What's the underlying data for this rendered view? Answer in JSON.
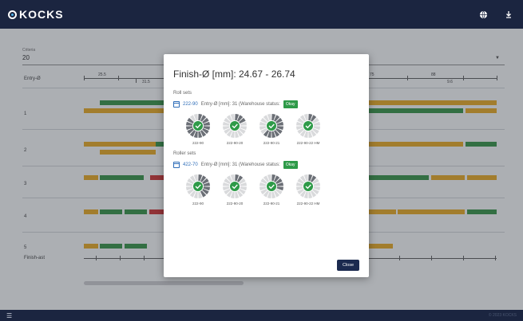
{
  "app": {
    "brand": "KOCKS"
  },
  "topbar": {
    "icons": [
      "globe-icon",
      "logout-icon"
    ]
  },
  "background": {
    "criteria": {
      "label": "Criteria",
      "value": "20"
    },
    "entry_label": "Entry-Ø",
    "rows": [
      {
        "label": "1"
      },
      {
        "label": "2"
      },
      {
        "label": "3"
      },
      {
        "label": "4"
      },
      {
        "label": "5"
      }
    ],
    "finish_label": "Finish-ast",
    "scale_values": [
      "25.5",
      "31.5",
      "75",
      "88",
      "9.6"
    ]
  },
  "modal": {
    "title": "Finish-Ø [mm]: 24.67 - 26.74",
    "sections": [
      {
        "label": "Roll sets",
        "set_id": "222-90",
        "info": "Entry-Ø [mm]: 31 (Warehouse status:",
        "status": "Okay",
        "gauges": [
          {
            "label": "222-90",
            "fill": 0.9
          },
          {
            "label": "222-90-20",
            "fill": 0.2
          },
          {
            "label": "222-90-21",
            "fill": 0.6
          },
          {
            "label": "222-90-22 HM",
            "fill": 0.1
          }
        ]
      },
      {
        "label": "Roller sets",
        "set_id": "422-70",
        "info": "Entry-Ø [mm]: 31 (Warehouse status:",
        "status": "Okay",
        "gauges": [
          {
            "label": "222-90",
            "fill": 0.45
          },
          {
            "label": "222-90-20",
            "fill": 0.1
          },
          {
            "label": "222-90-21",
            "fill": 0.3
          },
          {
            "label": "222-90-22 HM",
            "fill": 0.1
          }
        ]
      }
    ],
    "close_label": "Close"
  },
  "bottombar": {
    "menu_icon": "menu-icon",
    "version_text": "© 2023 KOCKS"
  },
  "colors": {
    "green": "#2e8b3e",
    "yellow": "#e1a21b",
    "red": "#c62a2a",
    "navy": "#1b2540",
    "okay": "#2e9a48"
  }
}
